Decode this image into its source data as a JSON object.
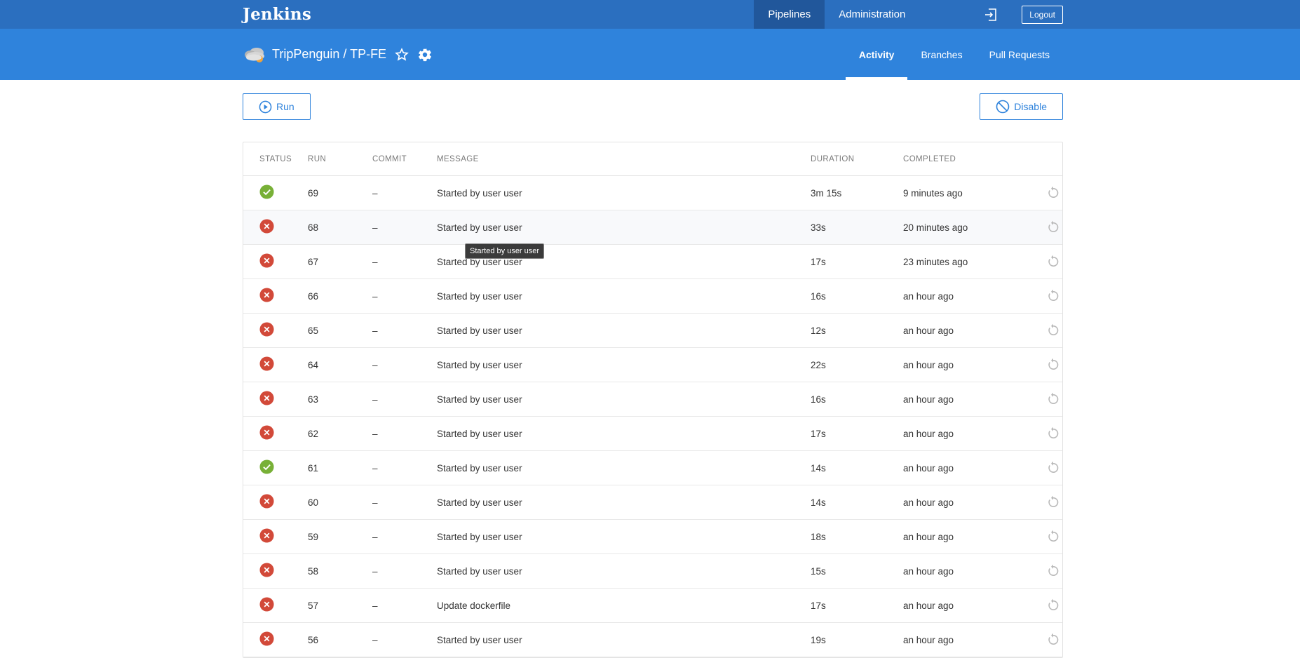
{
  "topbar": {
    "logo": "Jenkins",
    "nav": [
      {
        "label": "Pipelines",
        "active": true
      },
      {
        "label": "Administration",
        "active": false
      }
    ],
    "exit_icon": "exit-icon",
    "logout_label": "Logout"
  },
  "header": {
    "project_title": "TripPenguin / TP-FE",
    "weather_icon": "cloudy-weather-icon",
    "favorite_icon": "star-icon",
    "settings_icon": "gear-icon",
    "tabs": [
      {
        "label": "Activity",
        "active": true
      },
      {
        "label": "Branches",
        "active": false
      },
      {
        "label": "Pull Requests",
        "active": false
      }
    ]
  },
  "actions": {
    "run_label": "Run",
    "disable_label": "Disable"
  },
  "table": {
    "columns": [
      "STATUS",
      "RUN",
      "COMMIT",
      "MESSAGE",
      "DURATION",
      "COMPLETED"
    ],
    "rows": [
      {
        "status": "success",
        "run": "69",
        "commit": "–",
        "message": "Started by user user",
        "duration": "3m 15s",
        "completed": "9 minutes ago"
      },
      {
        "status": "failure",
        "run": "68",
        "commit": "–",
        "message": "Started by user user",
        "duration": "33s",
        "completed": "20 minutes ago"
      },
      {
        "status": "failure",
        "run": "67",
        "commit": "–",
        "message": "Started by user user",
        "duration": "17s",
        "completed": "23 minutes ago"
      },
      {
        "status": "failure",
        "run": "66",
        "commit": "–",
        "message": "Started by user user",
        "duration": "16s",
        "completed": "an hour ago"
      },
      {
        "status": "failure",
        "run": "65",
        "commit": "–",
        "message": "Started by user user",
        "duration": "12s",
        "completed": "an hour ago"
      },
      {
        "status": "failure",
        "run": "64",
        "commit": "–",
        "message": "Started by user user",
        "duration": "22s",
        "completed": "an hour ago"
      },
      {
        "status": "failure",
        "run": "63",
        "commit": "–",
        "message": "Started by user user",
        "duration": "16s",
        "completed": "an hour ago"
      },
      {
        "status": "failure",
        "run": "62",
        "commit": "–",
        "message": "Started by user user",
        "duration": "17s",
        "completed": "an hour ago"
      },
      {
        "status": "success",
        "run": "61",
        "commit": "–",
        "message": "Started by user user",
        "duration": "14s",
        "completed": "an hour ago"
      },
      {
        "status": "failure",
        "run": "60",
        "commit": "–",
        "message": "Started by user user",
        "duration": "14s",
        "completed": "an hour ago"
      },
      {
        "status": "failure",
        "run": "59",
        "commit": "–",
        "message": "Started by user user",
        "duration": "18s",
        "completed": "an hour ago"
      },
      {
        "status": "failure",
        "run": "58",
        "commit": "–",
        "message": "Started by user user",
        "duration": "15s",
        "completed": "an hour ago"
      },
      {
        "status": "failure",
        "run": "57",
        "commit": "–",
        "message": "Update dockerfile",
        "duration": "17s",
        "completed": "an hour ago"
      },
      {
        "status": "failure",
        "run": "56",
        "commit": "–",
        "message": "Started by user user",
        "duration": "19s",
        "completed": "an hour ago"
      }
    ],
    "hover_row": 1,
    "tooltip": "Started by user user"
  },
  "colors": {
    "topbar": "#2b6fbf",
    "header": "#2f83dc",
    "success": "#78b037",
    "failure": "#d24939",
    "accent": "#2f83dc"
  }
}
